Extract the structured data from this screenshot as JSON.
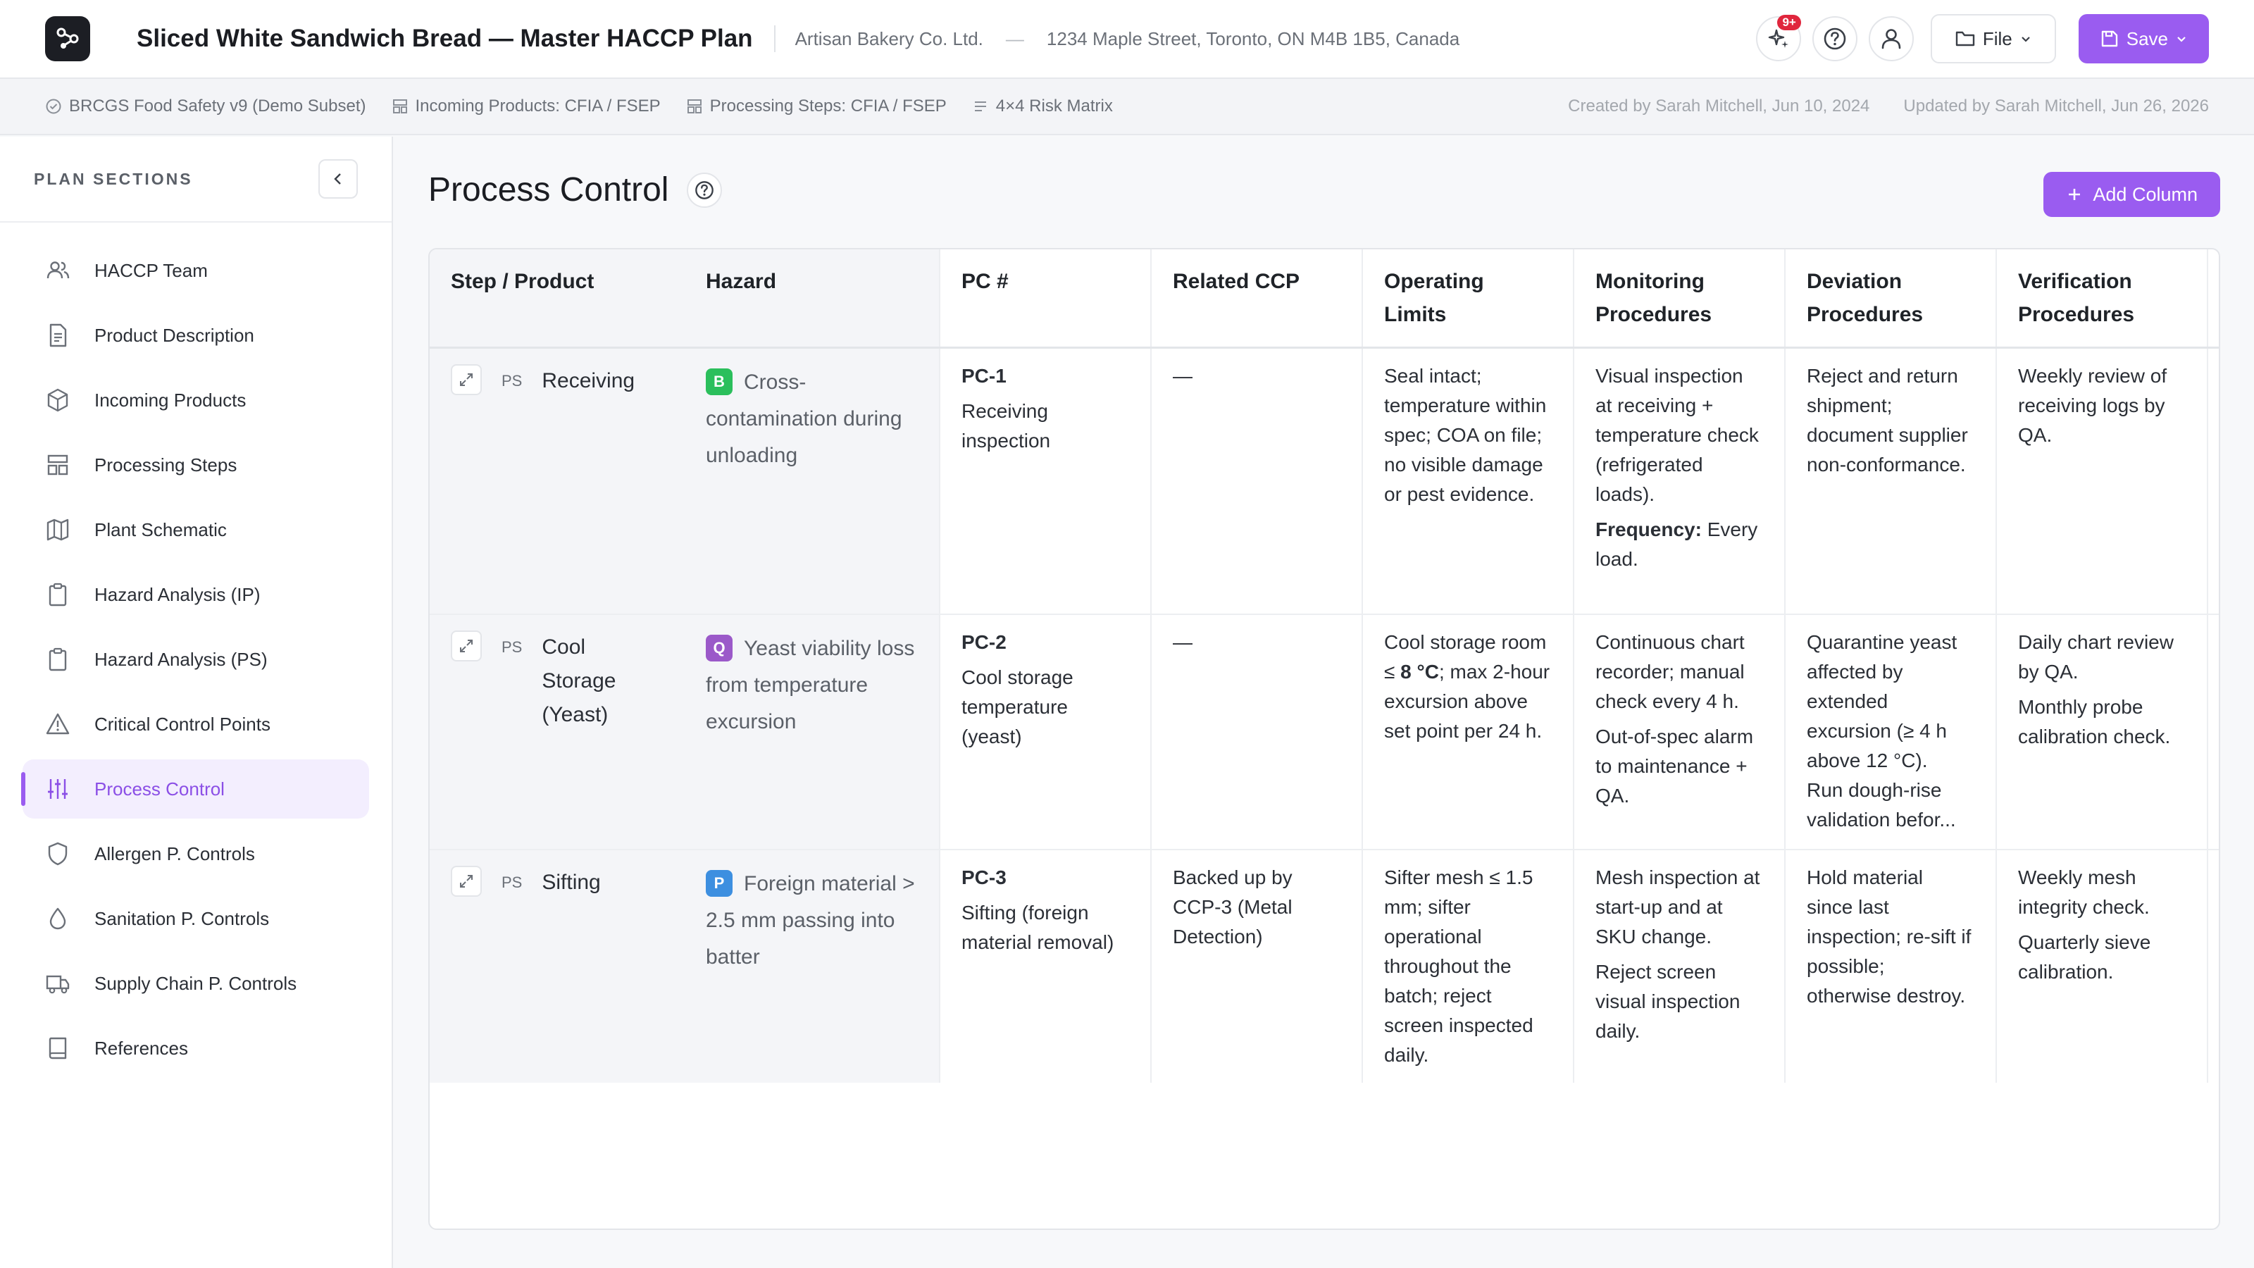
{
  "header": {
    "title": "Sliced White Sandwich Bread — Master HACCP Plan",
    "company": "Artisan Bakery Co. Ltd.",
    "separator": "—",
    "address": "1234 Maple Street, Toronto, ON M4B 1B5, Canada",
    "notification_badge": "9+",
    "file_label": "File",
    "save_label": "Save"
  },
  "subheader": {
    "standard": "BRCGS Food Safety v9 (Demo Subset)",
    "incoming": "Incoming Products: CFIA / FSEP",
    "processing": "Processing Steps: CFIA / FSEP",
    "matrix": "4×4 Risk Matrix",
    "created": "Created by Sarah Mitchell, Jun 10, 2024",
    "updated": "Updated by Sarah Mitchell, Jun 26, 2026"
  },
  "sidebar": {
    "heading": "PLAN SECTIONS",
    "items": [
      {
        "label": "HACCP Team",
        "icon": "team-icon"
      },
      {
        "label": "Product Description",
        "icon": "document-icon"
      },
      {
        "label": "Incoming Products",
        "icon": "box-icon"
      },
      {
        "label": "Processing Steps",
        "icon": "steps-icon"
      },
      {
        "label": "Plant Schematic",
        "icon": "map-icon"
      },
      {
        "label": "Hazard Analysis (IP)",
        "icon": "clipboard-icon"
      },
      {
        "label": "Hazard Analysis (PS)",
        "icon": "clipboard-icon"
      },
      {
        "label": "Critical Control Points",
        "icon": "warning-icon"
      },
      {
        "label": "Process Control",
        "icon": "sliders-icon"
      },
      {
        "label": "Allergen P. Controls",
        "icon": "shield-icon"
      },
      {
        "label": "Sanitation P. Controls",
        "icon": "droplet-icon"
      },
      {
        "label": "Supply Chain P. Controls",
        "icon": "truck-icon"
      },
      {
        "label": "References",
        "icon": "book-icon"
      }
    ],
    "active_index": 8
  },
  "main": {
    "title": "Process Control",
    "add_column_label": "Add Column"
  },
  "table": {
    "columns": [
      "Step / Product",
      "Hazard",
      "PC #",
      "Related CCP",
      "Operating Limits",
      "Monitoring Procedures",
      "Deviation Procedures",
      "Verification Procedures"
    ],
    "rows": [
      {
        "ps": "PS",
        "step": "Receiving",
        "hazard_tag": "B",
        "hazard": "Cross-contamination during unloading",
        "pc_num": "PC-1",
        "pc_name": "Receiving inspection",
        "ccp": "—",
        "limits": "Seal intact; temperature within spec; COA on file; no visible damage or pest evidence.",
        "monitoring": "Visual inspection at receiving + temperature check (refrigerated loads).",
        "freq_label": "Frequency:",
        "freq_value": "Every load.",
        "deviation": "Reject and return shipment; document supplier non-conformance.",
        "verification": "Weekly review of receiving logs by QA."
      },
      {
        "ps": "PS",
        "step": "Cool Storage (Yeast)",
        "hazard_tag": "Q",
        "hazard": "Yeast viability loss from temperature excursion",
        "pc_num": "PC-2",
        "pc_name": "Cool storage temperature (yeast)",
        "ccp": "—",
        "limits_a": "Cool storage room ≤ ",
        "limits_bold": "8 °C",
        "limits_b": "; max 2-hour excursion above set point per 24 h.",
        "monitoring_1": "Continuous chart recorder; manual check every 4 h.",
        "monitoring_2": "Out-of-spec alarm to maintenance + QA.",
        "deviation_1": "Quarantine yeast affected by extended excursion (≥ 4 h above 12 °C).",
        "deviation_2": "Run dough-rise validation befor...",
        "verification_1": "Daily chart review by QA.",
        "verification_2": "Monthly probe calibration check."
      },
      {
        "ps": "PS",
        "step": "Sifting",
        "hazard_tag": "P",
        "hazard": "Foreign material > 2.5 mm passing into batter",
        "pc_num": "PC-3",
        "pc_name": "Sifting (foreign material removal)",
        "ccp": "Backed up by CCP-3 (Metal Detection)",
        "limits": "Sifter mesh ≤ 1.5 mm; sifter operational throughout the batch; reject screen inspected daily.",
        "monitoring_1": "Mesh inspection at start-up and at SKU change.",
        "monitoring_2": "Reject screen visual inspection daily.",
        "deviation": "Hold material since last inspection; re-sift if possible; otherwise destroy.",
        "verification_1": "Weekly mesh integrity check.",
        "verification_2": "Quarterly sieve calibration."
      }
    ]
  },
  "colors": {
    "accent": "#9a5cf0",
    "active_bg": "#f3eefe",
    "tag_b": "#2bbf5c",
    "tag_q": "#9b59c9",
    "tag_p": "#3d8fe0",
    "badge": "#e0263d"
  }
}
